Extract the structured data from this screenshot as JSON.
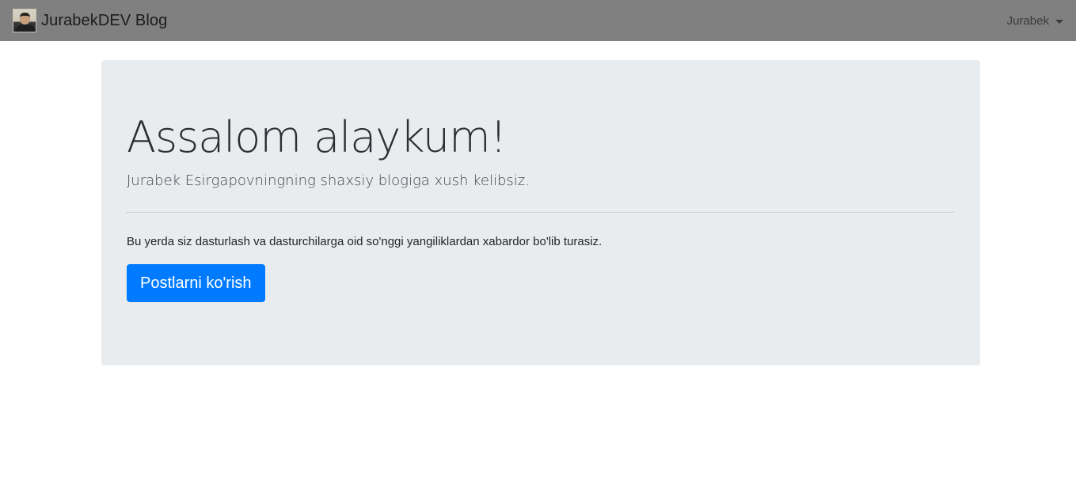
{
  "navbar": {
    "brand_text": "JurabekDEV Blog",
    "user_label": "Jurabek",
    "background_color": "#808080"
  },
  "jumbotron": {
    "title": "Assalom alaykum!",
    "lead": "Jurabek Esirgapovningning shaxsiy blogiga xush kelibsiz.",
    "body_text": "Bu yerda siz dasturlash va dasturchilarga oid so'nggi yangiliklardan xabardor bo'lib turasiz.",
    "button_label": "Postlarni ko'rish",
    "background_color": "#e9ecef",
    "button_color": "#007bff"
  },
  "icons": {
    "brand_logo": "avatar-photo",
    "user_menu": "caret-down-icon"
  }
}
